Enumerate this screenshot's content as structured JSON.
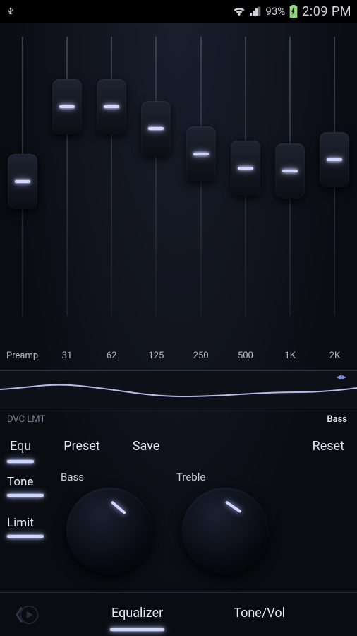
{
  "status": {
    "battery": "93%",
    "time": "2:09 PM"
  },
  "eq": {
    "bands": [
      {
        "label": "Preamp",
        "pos": 52
      },
      {
        "label": "31",
        "pos": 25
      },
      {
        "label": "62",
        "pos": 25
      },
      {
        "label": "125",
        "pos": 33
      },
      {
        "label": "250",
        "pos": 42
      },
      {
        "label": "500",
        "pos": 47
      },
      {
        "label": "1K",
        "pos": 48
      },
      {
        "label": "2K",
        "pos": 44
      }
    ]
  },
  "dvc": {
    "label": "DVC LMT",
    "right": "Bass"
  },
  "buttons": {
    "equ": "Equ",
    "preset": "Preset",
    "save": "Save",
    "reset": "Reset"
  },
  "toggles": {
    "tone": "Tone",
    "limit": "Limit"
  },
  "knobs": {
    "bass": "Bass",
    "treble": "Treble"
  },
  "tabs": {
    "equalizer": "Equalizer",
    "tonevol": "Tone/Vol"
  }
}
